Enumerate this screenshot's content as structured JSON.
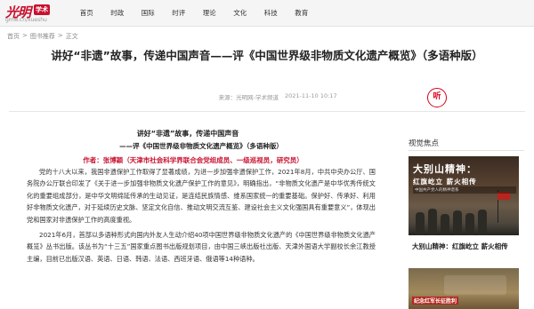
{
  "logo": {
    "text": "光明",
    "badge": "学术",
    "url": "gmw.cn/xueshu"
  },
  "nav": [
    "首页",
    "时政",
    "国际",
    "时评",
    "理论",
    "文化",
    "科技",
    "教育"
  ],
  "breadcrumb": [
    "首页",
    ">",
    "图书推荐",
    ">",
    "正文"
  ],
  "title": "讲好“非遗”故事，传递中国声音——评《中国世界级非物质文化遗产概览》（多语种版）",
  "meta": {
    "source": "来源：光明网-学术频道",
    "time": "2021-11-10 10:17",
    "audio_label": "听"
  },
  "article": {
    "heading": "讲好“非遗”故事，传递中国声音",
    "subheading": "——评《中国世界级非物质文化遗产概览》（多语种版）",
    "author": "作者：张博颖（天津市社会科学界联合会党组成员、一级巡视员，研究员）",
    "paragraphs": [
      "党的十八大以来，我国非遗保护工作取得了显著成绩，为进一步加强非遗保护工作，2021年8月，中共中央办公厅、国务院办公厅联合印发了《关于进一步加强非物质文化遗产保护工作的意见》，明确指出，“非物质文化遗产是中华优秀传统文化的重要组成部分，是中华文明绵延传承的生动见证，是连结民族情感、维系国家统一的重要基础。保护好、传承好、利用好非物质文化遗产，对于延续历史文脉、坚定文化自信、推动文明交流互鉴、建设社会主义文化强国具有重要意义”，体现出党和国家对非遗保护工作的高度重视。",
      "2021年6月，首部以多语种形式向国内外友人生动介绍40项中国世界级非物质文化遗产的《中国世界级非物质文化遗产概览》丛书出版。该丛书为“十三五”国家重点图书出版规划项目，由中国三峡出版社出版、天津外国语大学副校长余江教授主编，目前已出版汉语、英语、日语、韩语、法语、西班牙语、俄语等14种语种。"
    ]
  },
  "sidebar": {
    "title": "视觉焦点",
    "card1": {
      "headline": "大别山精神：",
      "subline": "红旗屹立  薪火相传",
      "note": "中国共产党人的精神谱系",
      "caption": "大别山精神：红旗屹立 薪火相传"
    },
    "card2": {
      "text": "纪念红军长征胜利"
    }
  }
}
